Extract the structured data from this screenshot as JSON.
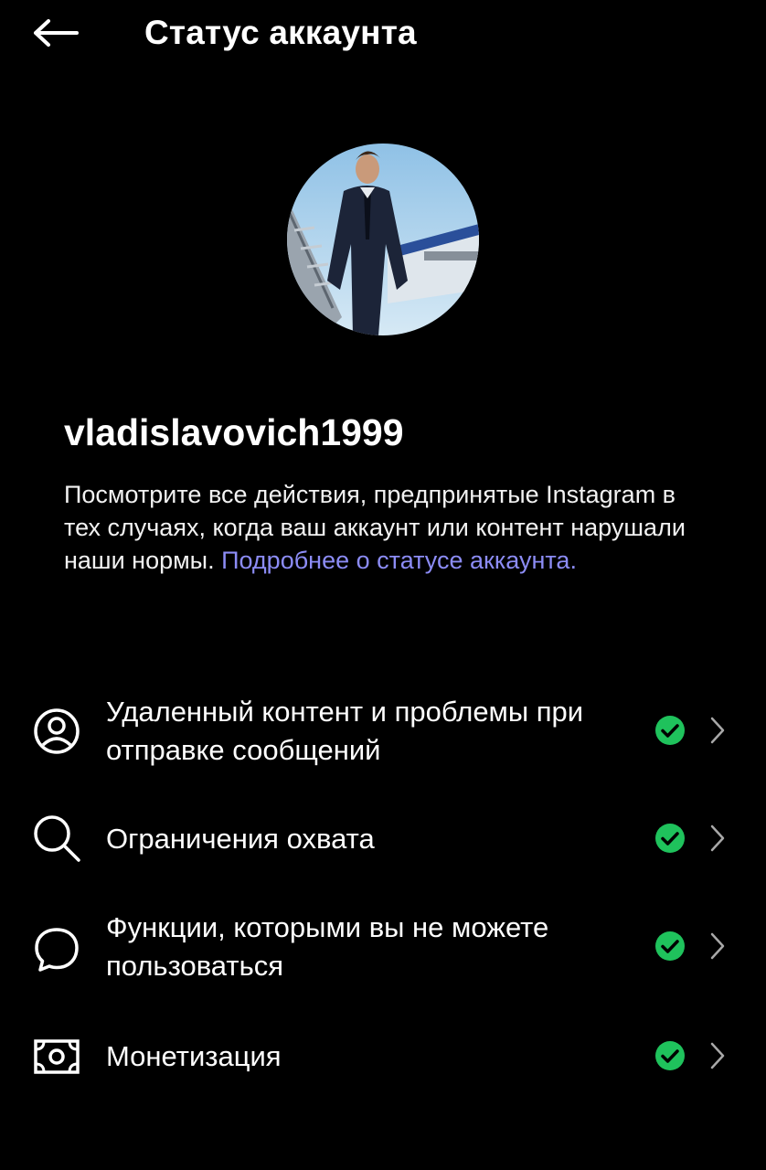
{
  "header": {
    "title": "Статус аккаунта",
    "back_icon": "arrow-left-icon"
  },
  "profile": {
    "avatar_icon": "profile-photo",
    "username": "vladislavovich1999"
  },
  "description": {
    "text": "Посмотрите все действия, предпринятые Instagram в тех случаях, когда ваш аккаунт или контент нарушали наши нормы. ",
    "link": "Подробнее о статусе аккаунта."
  },
  "menu": {
    "items": [
      {
        "label": "Удаленный контент и проблемы при отправке сообщений",
        "icon": "user-circle-icon",
        "status": "ok"
      },
      {
        "label": "Ограничения охвата",
        "icon": "search-icon",
        "status": "ok"
      },
      {
        "label": "Функции, которыми вы не можете пользоваться",
        "icon": "speech-bubble-icon",
        "status": "ok"
      },
      {
        "label": "Монетизация",
        "icon": "money-icon",
        "status": "ok"
      }
    ]
  },
  "colors": {
    "background": "#000000",
    "text": "#ffffff",
    "link": "#8c8cf5",
    "status_ok": "#1fc25c",
    "chevron": "#a8a8a8"
  }
}
